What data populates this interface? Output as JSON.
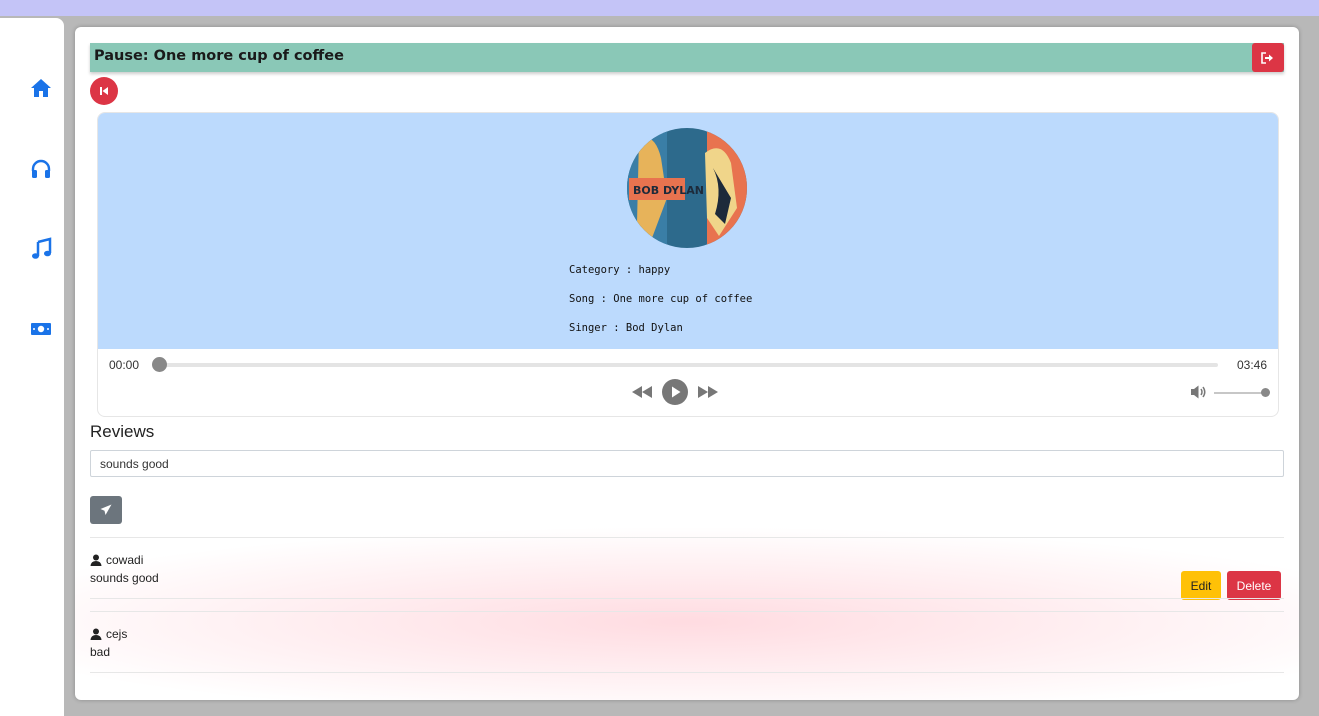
{
  "header": {
    "title": "Pause: One more cup of coffee"
  },
  "sidebar": {
    "items": [
      {
        "icon": "home-icon"
      },
      {
        "icon": "headphones-icon"
      },
      {
        "icon": "music-note-icon"
      },
      {
        "icon": "money-icon"
      }
    ],
    "accent": "#1a73e8"
  },
  "album": {
    "cover_text": "BOB DYLAN"
  },
  "track": {
    "category": "Category : happy",
    "song": "Song : One more cup of coffee",
    "singer": "Singer : Bod Dylan"
  },
  "player": {
    "current_time": "00:00",
    "duration": "03:46",
    "progress": 0,
    "volume": 1.0
  },
  "reviews": {
    "heading": "Reviews",
    "input_value": "sounds good",
    "items": [
      {
        "user": "cowadi",
        "text": "sounds good",
        "edit_label": "Edit",
        "delete_label": "Delete"
      },
      {
        "user": "cejs",
        "text": "bad"
      }
    ]
  },
  "colors": {
    "title_bar": "#8ac8b7",
    "player_bg": "#bcdafd",
    "danger": "#dc3545",
    "warning": "#ffc107",
    "secondary": "#6c757d"
  }
}
